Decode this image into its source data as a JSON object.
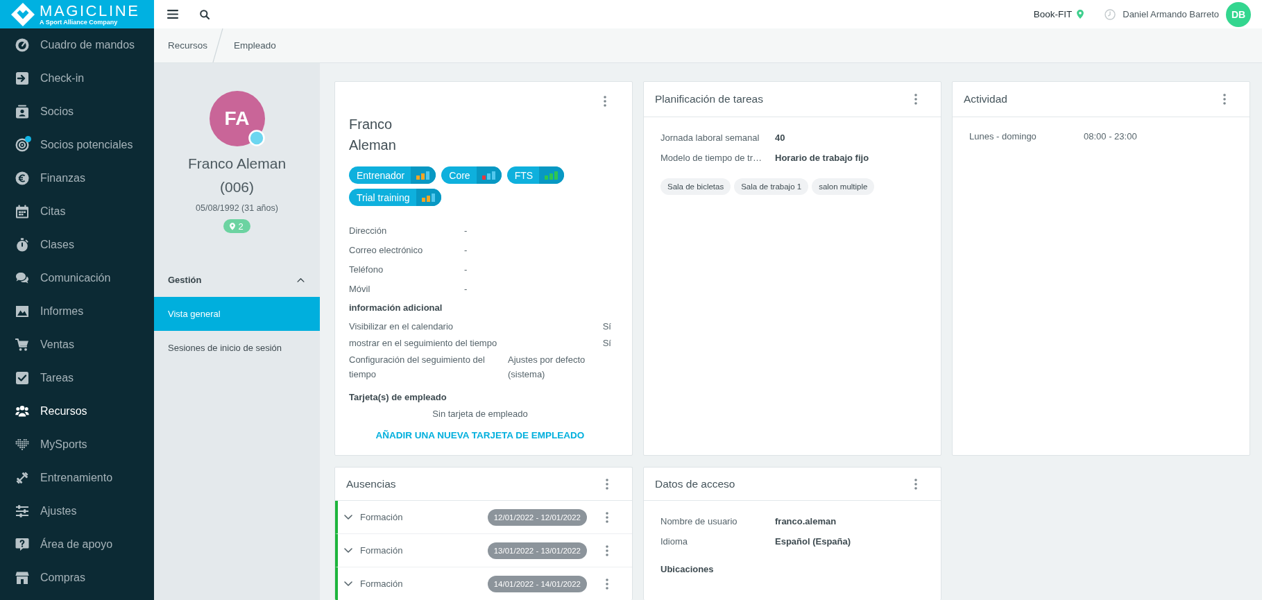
{
  "sidebar": {
    "logo": {
      "wordmark": "MAGICLINE",
      "tagline": "A Sport Alliance Company"
    },
    "items": [
      {
        "label": "Cuadro de mandos",
        "selected": false,
        "notification": false
      },
      {
        "label": "Check-in",
        "selected": false,
        "notification": false
      },
      {
        "label": "Socios",
        "selected": false,
        "notification": false
      },
      {
        "label": "Socios potenciales",
        "selected": false,
        "notification": true
      },
      {
        "label": "Finanzas",
        "selected": false,
        "notification": false
      },
      {
        "label": "Citas",
        "selected": false,
        "notification": false
      },
      {
        "label": "Clases",
        "selected": false,
        "notification": false
      },
      {
        "label": "Comunicación",
        "selected": false,
        "notification": false
      },
      {
        "label": "Informes",
        "selected": false,
        "notification": false
      },
      {
        "label": "Ventas",
        "selected": false,
        "notification": false
      },
      {
        "label": "Tareas",
        "selected": false,
        "notification": false
      },
      {
        "label": "Recursos",
        "selected": true,
        "notification": false
      },
      {
        "label": "MySports",
        "selected": false,
        "notification": false
      },
      {
        "label": "Entrenamiento",
        "selected": false,
        "notification": false
      },
      {
        "label": "Ajustes",
        "selected": false,
        "notification": false
      },
      {
        "label": "Área de apoyo",
        "selected": false,
        "notification": false
      },
      {
        "label": "Compras",
        "selected": false,
        "notification": false
      }
    ]
  },
  "top_bar": {
    "location": "Book-FIT",
    "user": {
      "name": "Daniel Armando Barreto",
      "initials": "DB"
    }
  },
  "breadcrumb": [
    "Recursos",
    "Empleado"
  ],
  "profile": {
    "initials": "FA",
    "name": "Franco Aleman",
    "number": "(006)",
    "birth_date": "05/08/1992 (31 años)",
    "locations": "2"
  },
  "profile_menu": {
    "sections": [
      {
        "title": "Gestión",
        "expanded": true,
        "items": [
          {
            "label": "Vista general",
            "selected": true
          },
          {
            "label": "Sesiones de inicio de sesión",
            "selected": false
          }
        ]
      }
    ]
  },
  "employee_card": {
    "first_name": "Franco",
    "last_name": "Aleman",
    "tags": [
      {
        "label": "Entrenador",
        "level": 0.67
      },
      {
        "label": "Core",
        "level": 0.33
      },
      {
        "label": "FTS",
        "level": 1
      },
      {
        "label": "Trial training",
        "level": 0.67
      }
    ],
    "contact": [
      {
        "label": "Dirección",
        "value": "-"
      },
      {
        "label": "Correo electrónico",
        "value": "-"
      },
      {
        "label": "Teléfono",
        "value": "-"
      },
      {
        "label": "Móvil",
        "value": "-"
      }
    ],
    "additional_title": "información adicional",
    "additional": [
      {
        "kind": "flag",
        "label": "Visibilizar en el calendario",
        "value": "Sí"
      },
      {
        "kind": "flag",
        "label": "mostrar en el seguimiento del tiempo",
        "value": "Sí"
      },
      {
        "kind": "setting",
        "label": "Configuración del seguimiento del tiempo",
        "value": "Ajustes por defecto (sistema)"
      }
    ],
    "cards_title": "Tarjeta(s) de empleado",
    "cards_empty": "Sin tarjeta de empleado",
    "add_card": "AÑADIR UNA NUEVA TARJETA DE EMPLEADO"
  },
  "task_planning": {
    "title": "Planificación de tareas",
    "fields": [
      {
        "label": "Jornada laboral semanal",
        "value": "40"
      },
      {
        "label": "Modelo de tiempo de tr…",
        "value": "Horario de trabajo fijo"
      }
    ],
    "rooms": [
      "Sala de bicletas",
      "Sala de trabajo 1",
      "salon multiple"
    ]
  },
  "activity": {
    "title": "Actividad",
    "rows": [
      {
        "days": "Lunes - domingo",
        "hours": "08:00 - 23:00"
      }
    ]
  },
  "absences": {
    "title": "Ausencias",
    "items": [
      {
        "type": "Formación",
        "dates": "12/01/2022 - 12/01/2022",
        "expanded": false
      },
      {
        "type": "Formación",
        "dates": "13/01/2022 - 13/01/2022",
        "expanded": false
      },
      {
        "type": "Formación",
        "dates": "14/01/2022 - 14/01/2022",
        "expanded": false
      }
    ]
  },
  "access_data": {
    "title": "Datos de acceso",
    "fields": [
      {
        "label": "Nombre de usuario",
        "value": "franco.aleman"
      },
      {
        "label": "Idioma",
        "value": "Español (España)"
      }
    ],
    "locations_title": "Ubicaciones"
  }
}
